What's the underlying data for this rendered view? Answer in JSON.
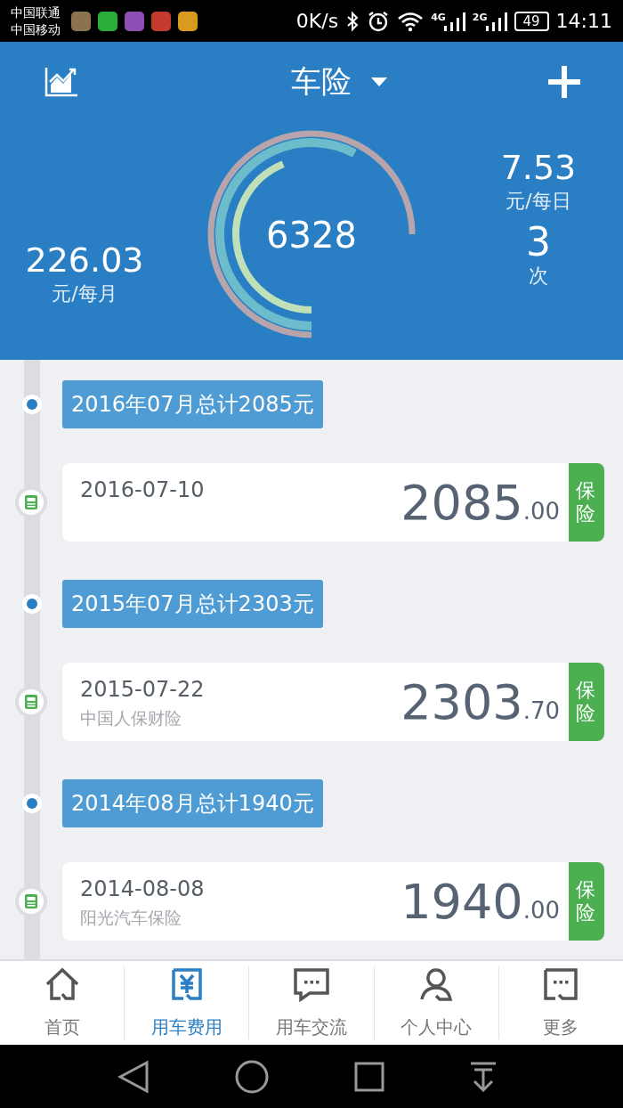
{
  "status_bar": {
    "carriers": [
      "中国联通",
      "中国移动"
    ],
    "speed": "0K/s",
    "network_1": "4G",
    "network_2": "2G",
    "battery": "49",
    "time": "14:11"
  },
  "header": {
    "title": "车险",
    "total": "6328",
    "monthly": {
      "value": "226.03",
      "unit": "元/每月"
    },
    "daily": {
      "value": "7.53",
      "unit": "元/每日"
    },
    "count": {
      "value": "3",
      "unit": "次"
    }
  },
  "timeline": [
    {
      "kind": "month",
      "label": "2016年07月总计2085元"
    },
    {
      "kind": "entry",
      "date": "2016-07-10",
      "amount": "2085",
      "cents": ".00",
      "tag": "保险"
    },
    {
      "kind": "month",
      "label": "2015年07月总计2303元"
    },
    {
      "kind": "entry",
      "date": "2015-07-22",
      "payee": "中国人保财险",
      "amount": "2303",
      "cents": ".70",
      "tag": "保险"
    },
    {
      "kind": "month",
      "label": "2014年08月总计1940元"
    },
    {
      "kind": "entry",
      "date": "2014-08-08",
      "payee": "阳光汽车保险",
      "amount": "1940",
      "cents": ".00",
      "tag": "保险"
    }
  ],
  "tab_bar": [
    {
      "label": "首页",
      "selected": false
    },
    {
      "label": "用车费用",
      "selected": true
    },
    {
      "label": "用车交流",
      "selected": false
    },
    {
      "label": "个人中心",
      "selected": false
    },
    {
      "label": "更多",
      "selected": false
    }
  ]
}
